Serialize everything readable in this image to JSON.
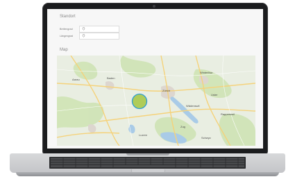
{
  "device": {
    "type": "laptop"
  },
  "standort": {
    "title": "Standort",
    "fields": [
      {
        "label": "Breitengrad",
        "value": "",
        "icon": "location-pin-icon"
      },
      {
        "label": "Längengrad",
        "value": "",
        "icon": "location-pin-icon"
      }
    ]
  },
  "map": {
    "title": "Map",
    "marker": {
      "shape": "circle",
      "fill": "#a8c84a",
      "stroke": "#2a9bd6"
    },
    "place_labels": [
      "Aarau",
      "Zürich",
      "Winterthur",
      "Baden",
      "Zug",
      "Luzern",
      "Wädenswil",
      "Uster",
      "Rapperswil",
      "Schwyz"
    ],
    "colors": {
      "land": "#e9eee2",
      "water": "#a9cbe7",
      "green": "#cfe3b5",
      "roads": "#f5d27a",
      "urban": "#ddd6cf"
    }
  }
}
